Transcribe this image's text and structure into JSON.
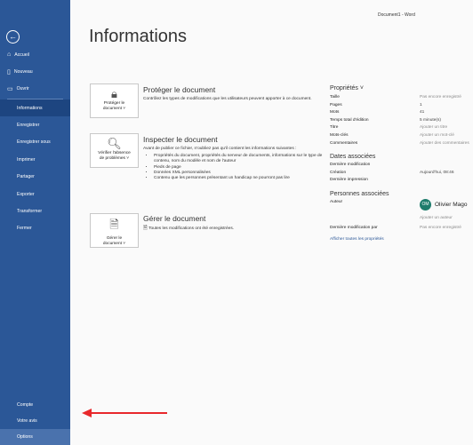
{
  "app": {
    "document_title": "Document1 - Word"
  },
  "sidebar": {
    "back_icon": "back-arrow-icon",
    "top_items": [
      {
        "label": "Accueil",
        "icon": "home-icon"
      },
      {
        "label": "Nouveau",
        "icon": "new-doc-icon"
      },
      {
        "label": "Ouvrir",
        "icon": "folder-icon"
      }
    ],
    "middle_items": [
      {
        "label": "Informations"
      },
      {
        "label": "Enregistrer"
      },
      {
        "label": "Enregistrer sous"
      },
      {
        "label": "Imprimer"
      },
      {
        "label": "Partager"
      },
      {
        "label": "Exporter"
      },
      {
        "label": "Transformer"
      },
      {
        "label": "Fermer"
      }
    ],
    "bottom_items": [
      {
        "label": "Compte"
      },
      {
        "label": "Votre avis"
      },
      {
        "label": "Options"
      }
    ],
    "active": "Informations",
    "highlighted": "Options"
  },
  "main": {
    "title": "Informations",
    "protect": {
      "button_line1": "Protéger le",
      "button_line2": "document ˅",
      "heading": "Protéger le document",
      "description": "Contrôlez les types de modifications que les utilisateurs peuvent apporter à ce document."
    },
    "inspect": {
      "button_line1": "Vérifier l'absence",
      "button_line2": "de problèmes ˅",
      "heading": "Inspecter le document",
      "description": "Avant de publier ce fichier, n'oubliez pas qu'il contient les informations suivantes :",
      "bullets": [
        "Propriétés du document, propriétés du serveur de documents, informations sur le type de contenu, nom du modèle et nom de l'auteur",
        "Pieds de page",
        "Données XML personnalisées",
        "Contenu que les personnes présentant un handicap ne pourront pas lire"
      ]
    },
    "manage": {
      "button_line1": "Gérer le",
      "button_line2": "document ˅",
      "heading": "Gérer le document",
      "status": "Toutes les modifications ont été enregistrées."
    }
  },
  "properties": {
    "heading": "Propriétés ˅",
    "rows": [
      {
        "key": "Taille",
        "value": "Pas encore enregistré",
        "muted": true
      },
      {
        "key": "Pages",
        "value": "1",
        "muted": false
      },
      {
        "key": "Mots",
        "value": "41",
        "muted": false
      },
      {
        "key": "Temps total d'édition",
        "value": "5 minute(s)",
        "muted": false
      },
      {
        "key": "Titre",
        "value": "Ajouter un titre",
        "muted": true
      },
      {
        "key": "Mots-clés",
        "value": "Ajouter un mot-clé",
        "muted": true
      },
      {
        "key": "Commentaires",
        "value": "Ajouter des commentaires",
        "muted": true
      }
    ],
    "dates_heading": "Dates associées",
    "dates": [
      {
        "key": "Dernière modification",
        "value": ""
      },
      {
        "key": "Création",
        "value": "Aujourd'hui, 08:46"
      },
      {
        "key": "Dernière impression",
        "value": ""
      }
    ],
    "people_heading": "Personnes associées",
    "author_label": "Auteur",
    "author_initials": "OM",
    "author_name": "Olivier Mago",
    "add_author": "Ajouter un auteur",
    "last_modified_by_label": "Dernière modification par",
    "last_modified_by_value": "Pas encore enregistré",
    "show_all_link": "Afficher toutes les propriétés"
  },
  "colors": {
    "sidebar": "#2b5797",
    "active_item": "#1d4580",
    "accent_arrow": "#e8282b",
    "avatar": "#1e7c6c"
  }
}
